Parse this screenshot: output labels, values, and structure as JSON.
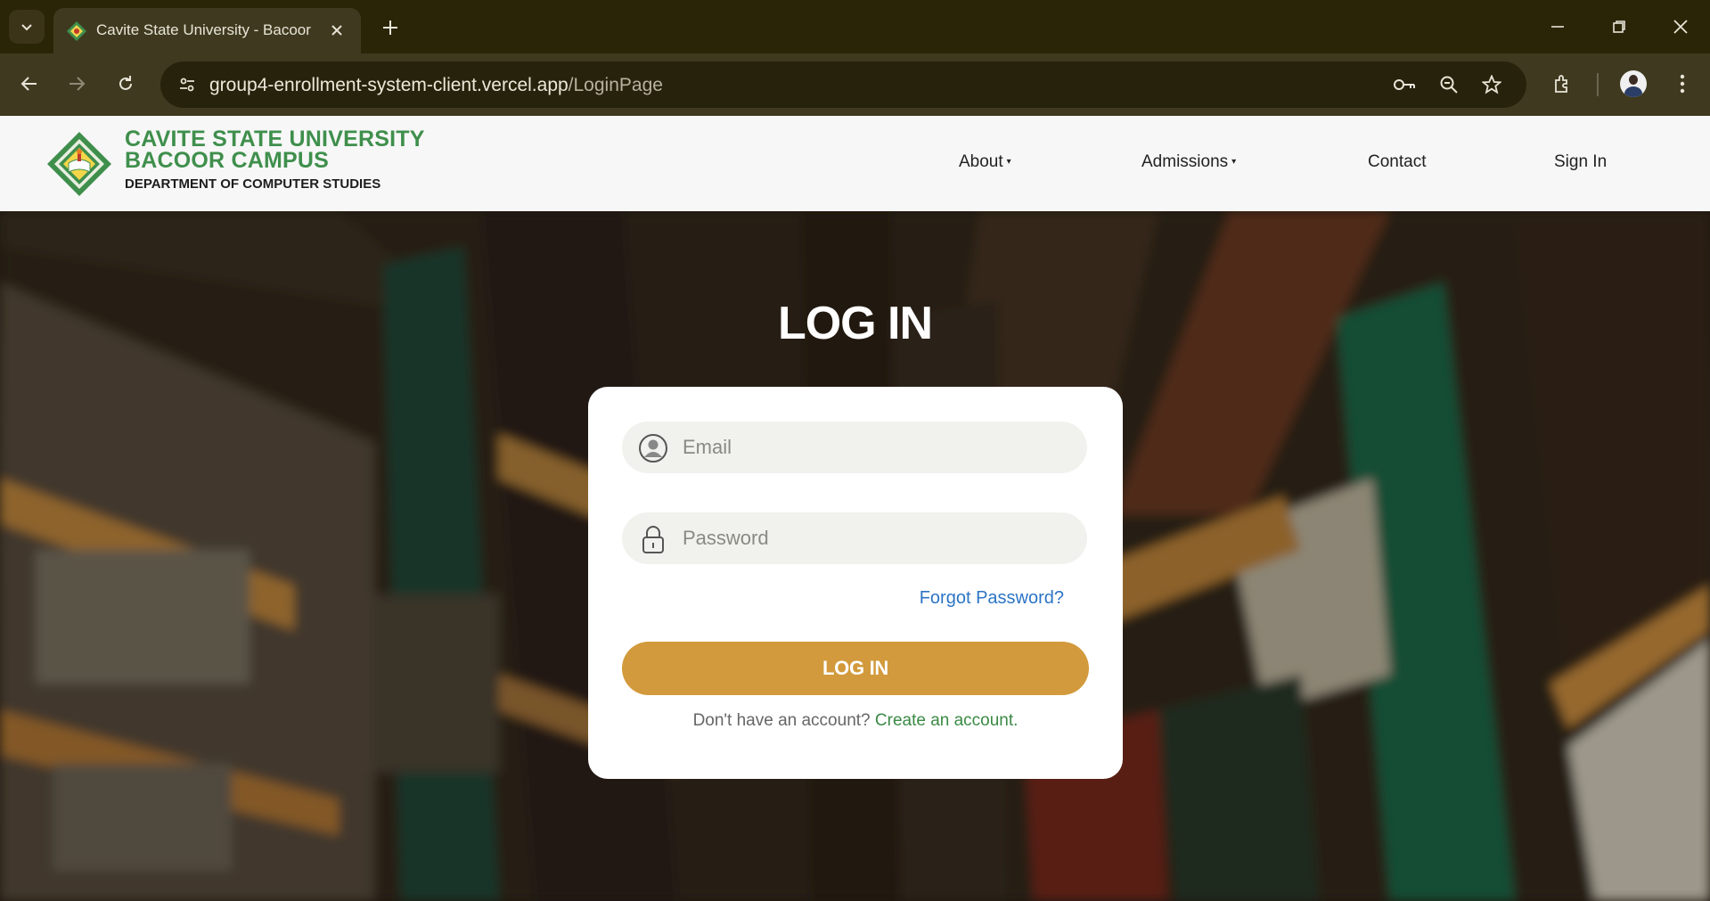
{
  "browser": {
    "tab_title": "Cavite State University - Bacoor",
    "url_host": "group4-enrollment-system-client.vercel.app",
    "url_path": "/LoginPage"
  },
  "header": {
    "brand_line1": "CAVITE STATE UNIVERSITY",
    "brand_line2": "BACOOR CAMPUS",
    "department": "DEPARTMENT OF COMPUTER STUDIES",
    "nav": [
      {
        "label": "About",
        "dropdown": true
      },
      {
        "label": "Admissions",
        "dropdown": true
      },
      {
        "label": "Contact",
        "dropdown": false
      },
      {
        "label": "Sign In",
        "dropdown": false
      }
    ],
    "caret": "▾"
  },
  "login": {
    "title": "LOG IN",
    "email_placeholder": "Email",
    "password_placeholder": "Password",
    "forgot_label": "Forgot Password?",
    "button_label": "LOG IN",
    "no_account_text": "Don't have an account?",
    "create_account_label": "Create an account."
  },
  "colors": {
    "brand_green": "#3f8f4c",
    "button_gold": "#d29a3c",
    "link_blue": "#2c74c5",
    "chrome_dark": "#2b2508"
  }
}
